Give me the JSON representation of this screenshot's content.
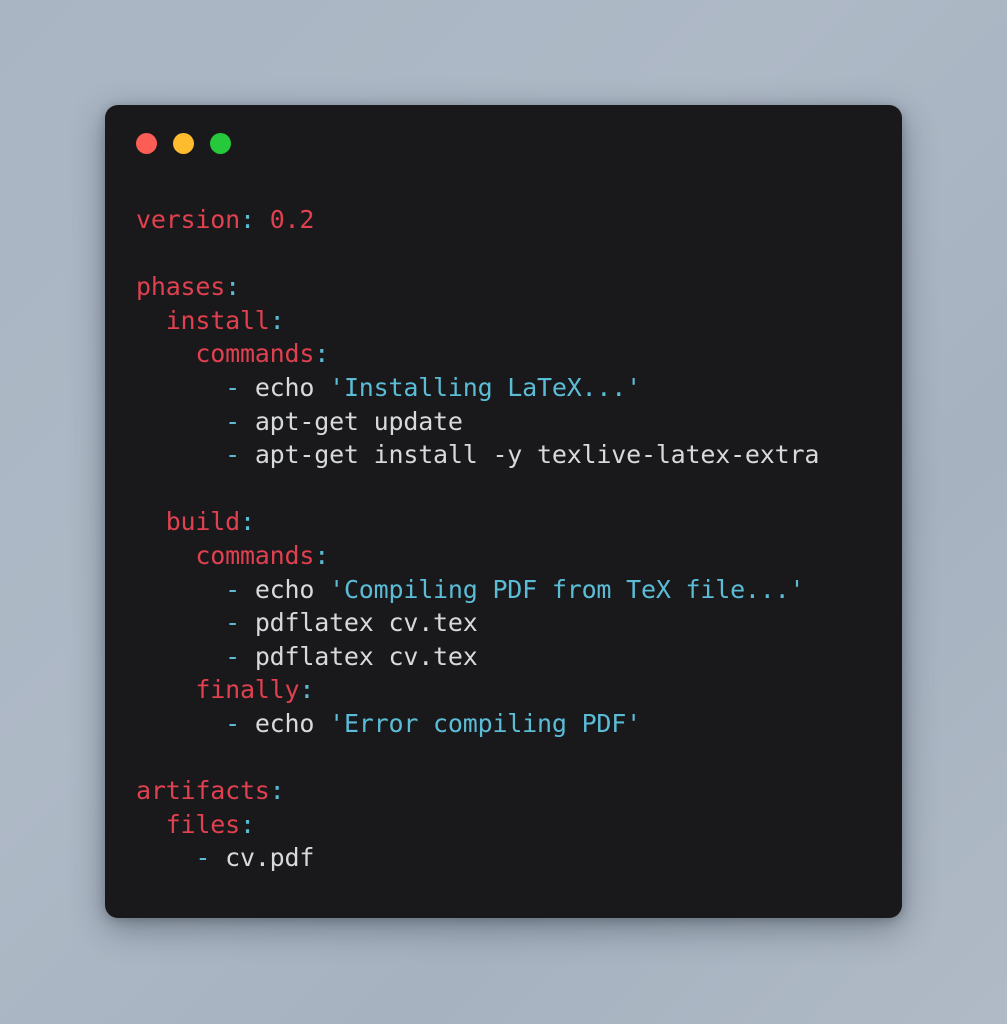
{
  "window": {
    "name": "terminal-window",
    "background": "#19191b",
    "page_background_from": "#a9b5c3",
    "page_background_to": "#b0bac6",
    "titlebar": {
      "buttons": [
        {
          "name": "close",
          "label": "Close",
          "color": "#fc5d55"
        },
        {
          "name": "minimize",
          "label": "Minimize",
          "color": "#fdbc2e"
        },
        {
          "name": "zoom",
          "label": "Zoom",
          "color": "#26c83c"
        }
      ]
    }
  },
  "theme": {
    "key": "#e0404f",
    "punctuation": "#5bbcd6",
    "dash": "#5bbcd6",
    "number": "#e0404f",
    "plain": "#d7d9da",
    "string": "#5bbcd6"
  },
  "code": {
    "language": "yaml",
    "raw": "version: 0.2\n\nphases:\n  install:\n    commands:\n      - echo 'Installing LaTeX...'\n      - apt-get update\n      - apt-get install -y texlive-latex-extra\n\n  build:\n    commands:\n      - echo 'Compiling PDF from TeX file...'\n      - pdflatex cv.tex\n      - pdflatex cv.tex\n    finally:\n      - echo 'Error compiling PDF'\n\nartifacts:\n  files:\n    - cv.pdf",
    "lines": [
      {
        "indent": 0,
        "tokens": [
          {
            "t": "key",
            "v": "version"
          },
          {
            "t": "punct",
            "v": ":"
          },
          {
            "t": "space",
            "v": " "
          },
          {
            "t": "num",
            "v": "0.2"
          }
        ]
      },
      {
        "indent": 0,
        "tokens": []
      },
      {
        "indent": 0,
        "tokens": [
          {
            "t": "key",
            "v": "phases"
          },
          {
            "t": "punct",
            "v": ":"
          }
        ]
      },
      {
        "indent": 2,
        "tokens": [
          {
            "t": "key",
            "v": "install"
          },
          {
            "t": "punct",
            "v": ":"
          }
        ]
      },
      {
        "indent": 4,
        "tokens": [
          {
            "t": "key",
            "v": "commands"
          },
          {
            "t": "punct",
            "v": ":"
          }
        ]
      },
      {
        "indent": 6,
        "tokens": [
          {
            "t": "dash",
            "v": "-"
          },
          {
            "t": "space",
            "v": " "
          },
          {
            "t": "plain",
            "v": "echo"
          },
          {
            "t": "space",
            "v": " "
          },
          {
            "t": "str",
            "v": "'Installing LaTeX...'"
          }
        ]
      },
      {
        "indent": 6,
        "tokens": [
          {
            "t": "dash",
            "v": "-"
          },
          {
            "t": "space",
            "v": " "
          },
          {
            "t": "plain",
            "v": "apt-get update"
          }
        ]
      },
      {
        "indent": 6,
        "tokens": [
          {
            "t": "dash",
            "v": "-"
          },
          {
            "t": "space",
            "v": " "
          },
          {
            "t": "plain",
            "v": "apt-get install -y texlive-latex-extra"
          }
        ]
      },
      {
        "indent": 0,
        "tokens": []
      },
      {
        "indent": 2,
        "tokens": [
          {
            "t": "key",
            "v": "build"
          },
          {
            "t": "punct",
            "v": ":"
          }
        ]
      },
      {
        "indent": 4,
        "tokens": [
          {
            "t": "key",
            "v": "commands"
          },
          {
            "t": "punct",
            "v": ":"
          }
        ]
      },
      {
        "indent": 6,
        "tokens": [
          {
            "t": "dash",
            "v": "-"
          },
          {
            "t": "space",
            "v": " "
          },
          {
            "t": "plain",
            "v": "echo"
          },
          {
            "t": "space",
            "v": " "
          },
          {
            "t": "str",
            "v": "'Compiling PDF from TeX file...'"
          }
        ]
      },
      {
        "indent": 6,
        "tokens": [
          {
            "t": "dash",
            "v": "-"
          },
          {
            "t": "space",
            "v": " "
          },
          {
            "t": "plain",
            "v": "pdflatex cv.tex"
          }
        ]
      },
      {
        "indent": 6,
        "tokens": [
          {
            "t": "dash",
            "v": "-"
          },
          {
            "t": "space",
            "v": " "
          },
          {
            "t": "plain",
            "v": "pdflatex cv.tex"
          }
        ]
      },
      {
        "indent": 4,
        "tokens": [
          {
            "t": "key",
            "v": "finally"
          },
          {
            "t": "punct",
            "v": ":"
          }
        ]
      },
      {
        "indent": 6,
        "tokens": [
          {
            "t": "dash",
            "v": "-"
          },
          {
            "t": "space",
            "v": " "
          },
          {
            "t": "plain",
            "v": "echo"
          },
          {
            "t": "space",
            "v": " "
          },
          {
            "t": "str",
            "v": "'Error compiling PDF'"
          }
        ]
      },
      {
        "indent": 0,
        "tokens": []
      },
      {
        "indent": 0,
        "tokens": [
          {
            "t": "key",
            "v": "artifacts"
          },
          {
            "t": "punct",
            "v": ":"
          }
        ]
      },
      {
        "indent": 2,
        "tokens": [
          {
            "t": "key",
            "v": "files"
          },
          {
            "t": "punct",
            "v": ":"
          }
        ]
      },
      {
        "indent": 4,
        "tokens": [
          {
            "t": "dash",
            "v": "-"
          },
          {
            "t": "space",
            "v": " "
          },
          {
            "t": "plain",
            "v": "cv.pdf"
          }
        ]
      }
    ]
  }
}
